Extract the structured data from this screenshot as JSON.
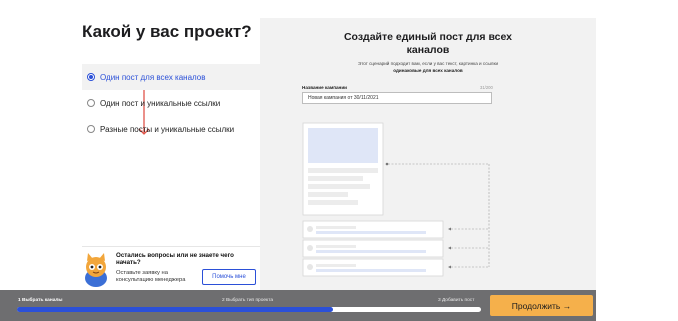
{
  "left": {
    "heading": "Какой у вас проект?",
    "options": [
      {
        "label": "Один пост для всех каналов",
        "selected": true
      },
      {
        "label": "Один пост и уникальные ссылки",
        "selected": false
      },
      {
        "label": "Разные посты и уникальные ссылки",
        "selected": false
      }
    ],
    "help": {
      "question": "Остались вопросы или не знаете чего начать?",
      "subtitle": "Оставьте заявку на консультацию менеджера",
      "button_label": "Помочь мне"
    }
  },
  "right": {
    "title_line1": "Создайте единый пост для всех",
    "title_line2": "каналов",
    "desc_line1": "Этот сценарий подходит вам, если у вас текст, картинка и ссылки",
    "desc_line2": "одинаковые для всех каналов",
    "campaign_label": "Название кампании",
    "campaign_counter": "31/200",
    "campaign_value": "Новая кампания от 30/11/2021"
  },
  "footer": {
    "steps": [
      "1 Выбрать каналы",
      "2 Выбрать тип проекта",
      "3 Добавить пост"
    ],
    "progress": 0.68,
    "cta_label": "Продолжить →"
  },
  "colors": {
    "accent": "#2b50d8",
    "cta": "#f5b04b",
    "arrow": "#e0554a",
    "footer_bg": "#6e6e70",
    "panel_bg": "#f2f2f2"
  }
}
